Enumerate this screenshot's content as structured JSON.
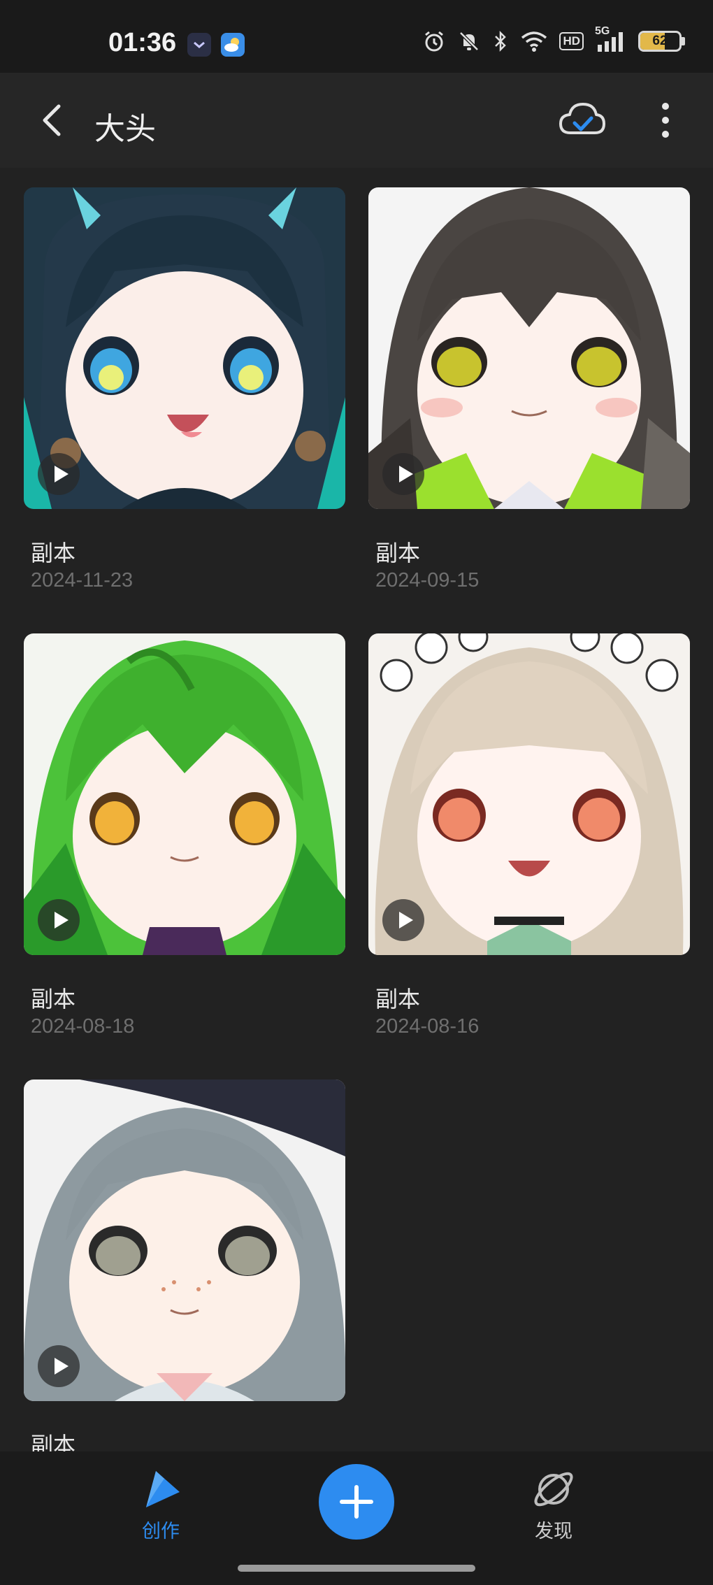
{
  "status_bar": {
    "time": "01:36",
    "network": "5G",
    "hd_label": "HD",
    "battery_percent": "62",
    "battery_level": 0.62
  },
  "header": {
    "title": "大头"
  },
  "works": [
    {
      "name": "副本",
      "date": "2024-11-23"
    },
    {
      "name": "副本",
      "date": "2024-09-15"
    },
    {
      "name": "副本",
      "date": "2024-08-18"
    },
    {
      "name": "副本",
      "date": "2024-08-16"
    },
    {
      "name": "副本",
      "date": ""
    }
  ],
  "bottom_nav": {
    "create_label": "创作",
    "discover_label": "发现"
  },
  "colors": {
    "accent": "#2d8cf0",
    "background": "#222222"
  }
}
